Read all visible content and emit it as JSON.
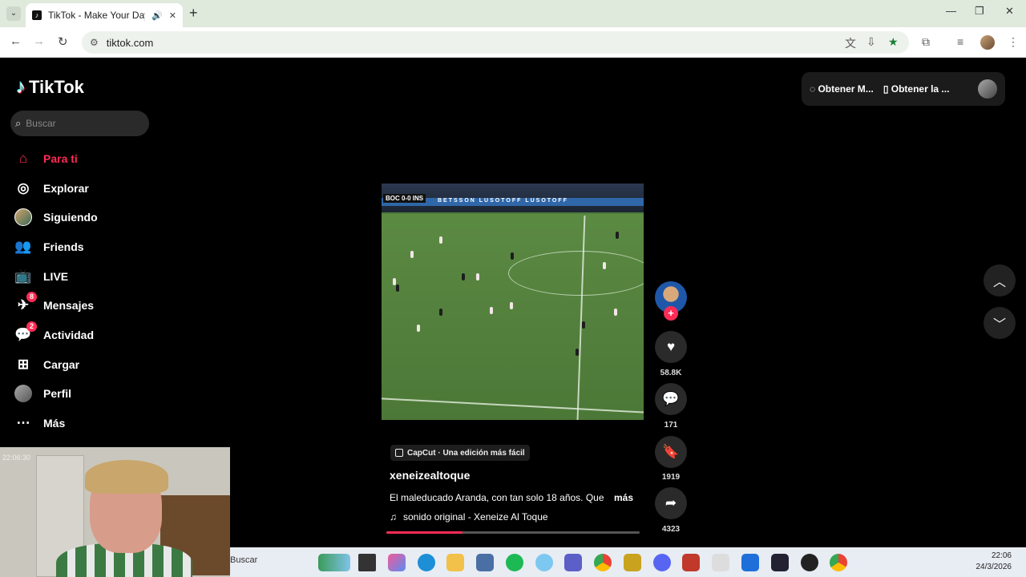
{
  "browser": {
    "tab_title": "TikTok - Make Your Day",
    "url": "tiktok.com"
  },
  "tiktok": {
    "logo": "TikTok",
    "search_placeholder": "Buscar",
    "nav": [
      {
        "label": "Para ti",
        "icon": "home-icon",
        "active": true
      },
      {
        "label": "Explorar",
        "icon": "compass-icon"
      },
      {
        "label": "Siguiendo",
        "icon": "following-avatar-icon"
      },
      {
        "label": "Friends",
        "icon": "friends-icon"
      },
      {
        "label": "LIVE",
        "icon": "live-icon"
      },
      {
        "label": "Mensajes",
        "icon": "messages-icon",
        "badge": "8"
      },
      {
        "label": "Actividad",
        "icon": "activity-icon",
        "badge": "2"
      },
      {
        "label": "Cargar",
        "icon": "upload-icon"
      },
      {
        "label": "Perfil",
        "icon": "profile-avatar-icon"
      },
      {
        "label": "Más",
        "icon": "more-icon"
      }
    ],
    "topbar": {
      "get_coins": "Obtener M...",
      "get_app": "Obtener la ..."
    },
    "video": {
      "score_text": "BOC 0-0 INS",
      "board_text": "BETSSON  LUSOTOFF  LUSOTOFF",
      "capcut_label": "CapCut · Una edición más fácil",
      "author": "xeneizealtoque",
      "description": "El maleducado Aranda, con tan solo 18 años. Que",
      "more": "más",
      "music": "sonido original - Xeneize Al Toque",
      "progress": 0.3
    },
    "actions": {
      "likes": "58.8K",
      "comments": "171",
      "saves": "1919",
      "shares": "4323"
    }
  },
  "webcam": {
    "timestamp": "22:06:30"
  },
  "taskbar": {
    "search": "Buscar",
    "time": "22:06",
    "date": "24/3/2026"
  }
}
